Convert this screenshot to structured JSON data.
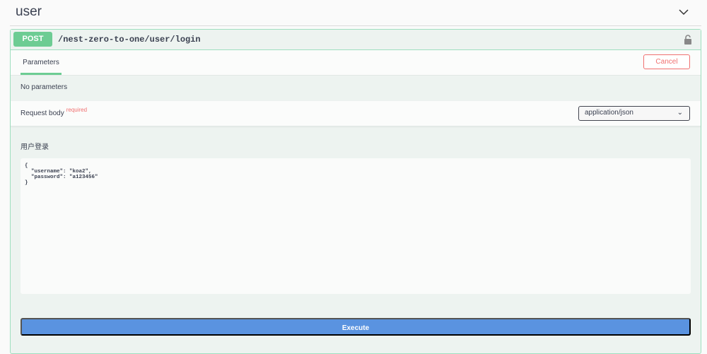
{
  "tag": {
    "title": "user"
  },
  "operation": {
    "method": "POST",
    "path": "/nest-zero-to-one/user/login",
    "tab_label": "Parameters",
    "cancel_label": "Cancel",
    "no_params": "No parameters",
    "request_body_label": "Request body",
    "required_label": "required",
    "content_type": "application/json",
    "description": "用户登录",
    "body": "{\n  \"username\": \"koa2\",\n  \"password\": \"a123456\"\n}",
    "execute_label": "Execute"
  },
  "colors": {
    "post": "#6dcc93",
    "cancel": "#f07070",
    "execute": "#5a93e0"
  }
}
